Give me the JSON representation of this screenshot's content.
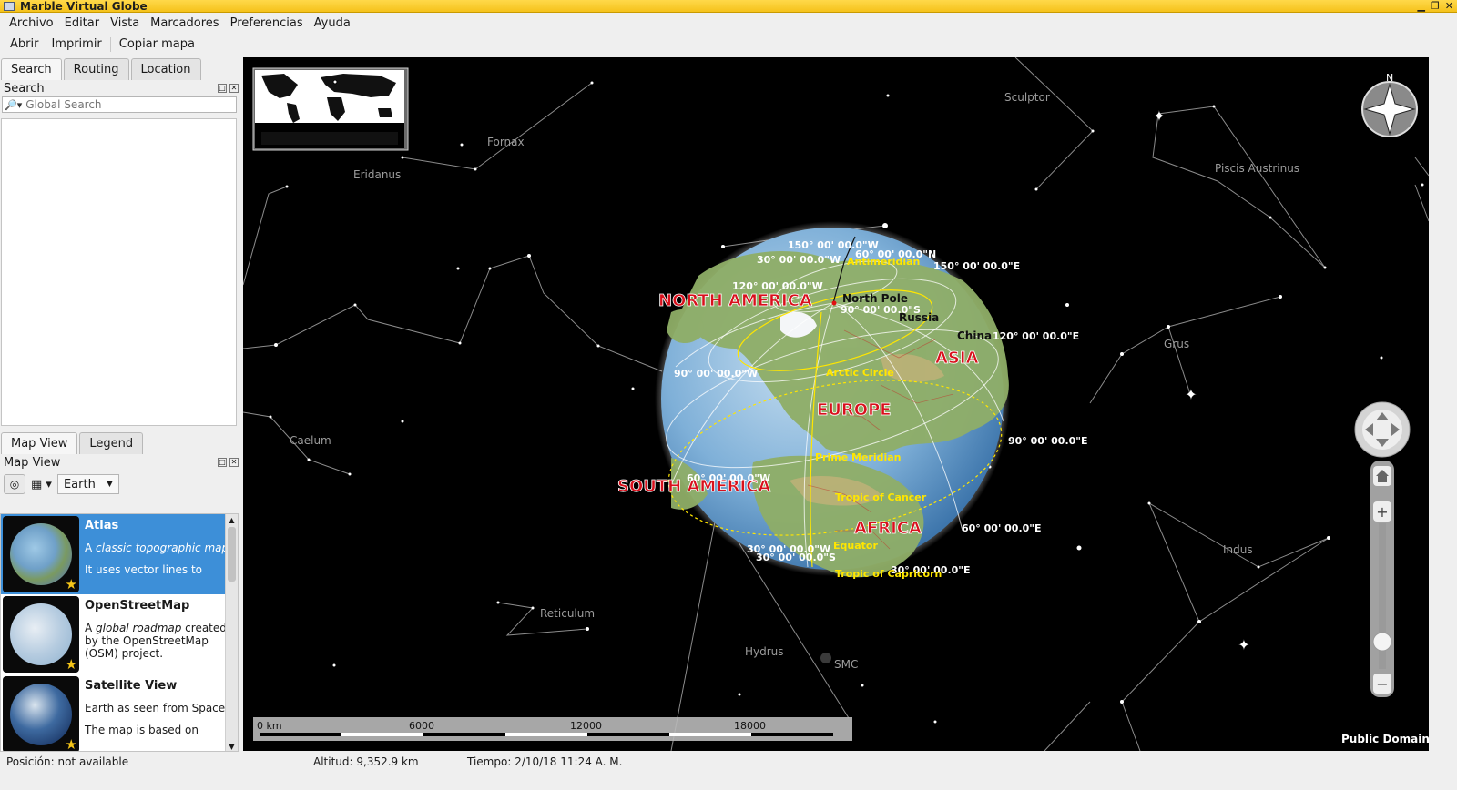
{
  "window": {
    "title": "Marble Virtual Globe"
  },
  "menu": [
    "Archivo",
    "Editar",
    "Vista",
    "Marcadores",
    "Preferencias",
    "Ayuda"
  ],
  "toolbar": {
    "open": "Abrir",
    "print": "Imprimir",
    "copy_map": "Copiar mapa"
  },
  "left_tabs": [
    "Search",
    "Routing",
    "Location"
  ],
  "search": {
    "title": "Search",
    "placeholder": "Global Search"
  },
  "bottom_tabs": [
    "Map View",
    "Legend"
  ],
  "map_view": {
    "title": "Map View",
    "planet": "Earth"
  },
  "maps": [
    {
      "name": "Atlas",
      "desc1_pre": "A ",
      "desc1_em": "classic topographic map.",
      "desc2": "It uses vector lines to"
    },
    {
      "name": "OpenStreetMap",
      "desc1_pre": "A ",
      "desc1_em": "global roadmap",
      "desc1_post": " created by the OpenStreetMap (OSM) project."
    },
    {
      "name": "Satellite View",
      "desc1": "Earth as seen from Space.",
      "desc2": "The map is based on"
    }
  ],
  "constellations": [
    "Sculptor",
    "Fornax",
    "Eridanus",
    "Piscis Austrinus",
    "Grus",
    "Caelum",
    "Reticulum",
    "Hydrus",
    "SMC",
    "Indus"
  ],
  "continents": [
    "NORTH AMERICA",
    "ASIA",
    "EUROPE",
    "SOUTH AMERICA",
    "AFRICA"
  ],
  "places": [
    "North Pole",
    "Russia",
    "China"
  ],
  "grid_labels": [
    "150° 00' 00.0\"W",
    "60° 00' 00.0\"N",
    "150° 00' 00.0\"E",
    "30° 00' 00.0\"W",
    "120° 00' 00.0\"W",
    "90° 00' 00.0\"S",
    "120° 00' 00.0\"E",
    "90° 00' 00.0\"W",
    "90° 00' 00.0\"E",
    "60° 00' 00.0\"W",
    "60° 00' 00.0\"E",
    "30° 00' 00.0\"W",
    "30° 00' 00.0\"S",
    "30° 00' 00.0\"E"
  ],
  "yellow_labels": [
    "Antimeridian",
    "Arctic Circle",
    "Prime Meridian",
    "Tropic of Cancer",
    "Equator",
    "Tropic of Capricorn"
  ],
  "scale": {
    "ticks": [
      "0 km",
      "6000",
      "12000",
      "18000"
    ]
  },
  "compass_label": "N",
  "license": "Public Domain",
  "status": {
    "position": "Posición: not available",
    "altitude": "Altitud:  9,352.9 km",
    "time": "Tiempo: 2/10/18 11:24 A. M."
  },
  "colors": {
    "title_bar": "#f5c21b",
    "selection": "#3d8fd8",
    "continent_label": "#d8101c",
    "grid_label_yellow": "#ffe600"
  }
}
